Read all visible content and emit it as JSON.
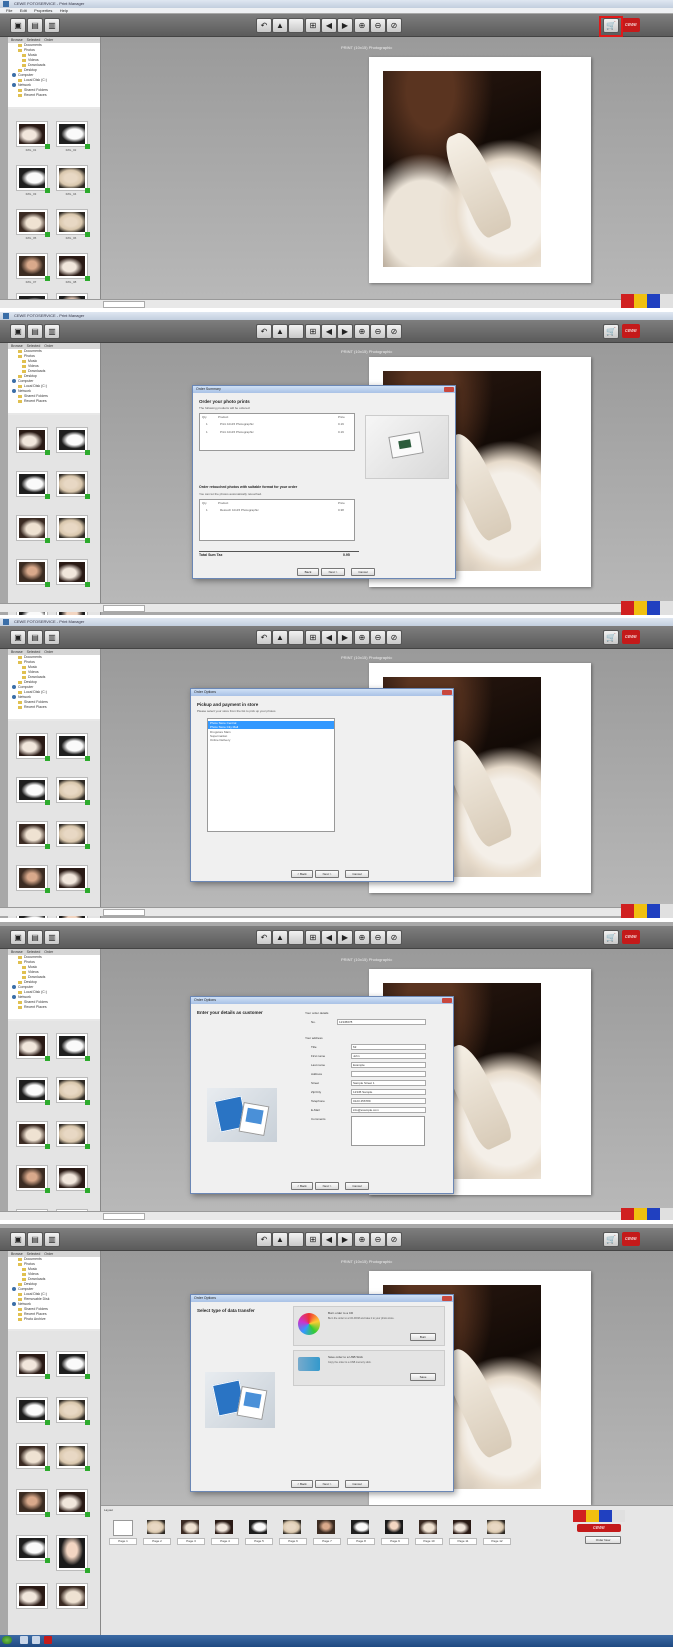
{
  "app": {
    "title": "CEWE FOTOSERVICE - Print Manager",
    "menu": [
      "File",
      "Edit",
      "Properties",
      "Help"
    ],
    "page_title": "PRINT (10x15) Photographic"
  },
  "toolbar": {
    "left_buttons": [
      {
        "name": "new-icon",
        "glyph": "▣"
      },
      {
        "name": "open-folder-icon",
        "glyph": "▤"
      },
      {
        "name": "save-icon",
        "glyph": "▥"
      }
    ],
    "center_buttons": [
      {
        "name": "undo-icon",
        "glyph": "↶"
      },
      {
        "name": "image-icon",
        "glyph": "▲"
      },
      {
        "name": "blank-icon",
        "glyph": " "
      },
      {
        "name": "grid-icon",
        "glyph": "⊞"
      },
      {
        "name": "prev-icon",
        "glyph": "◀"
      },
      {
        "name": "next-icon",
        "glyph": "▶"
      },
      {
        "name": "zoom-in-icon",
        "glyph": "⊕"
      },
      {
        "name": "zoom-out-icon",
        "glyph": "⊖"
      },
      {
        "name": "zoom-fit-icon",
        "glyph": "⊘"
      }
    ],
    "order_button": {
      "name": "order-cart-icon",
      "glyph": "🛒"
    },
    "logo_text": "cewe"
  },
  "sidebar": {
    "tabs": [
      "Browse",
      "Selected",
      "Order",
      "Print Attributes"
    ],
    "tree": [
      {
        "label": "Documents",
        "level": 1
      },
      {
        "label": "Photos",
        "level": 1
      },
      {
        "label": "Music",
        "level": 1
      },
      {
        "label": "Videos",
        "level": 1
      },
      {
        "label": "Downloads",
        "level": 1
      },
      {
        "label": "Desktop",
        "level": 1
      },
      {
        "label": "Computer",
        "level": 0
      },
      {
        "label": "Local Disk (C:)",
        "level": 1
      },
      {
        "label": "Removable Disk",
        "level": 1
      },
      {
        "label": "Network",
        "level": 0
      },
      {
        "label": "Shared Folders",
        "level": 1
      },
      {
        "label": "Recent Places",
        "level": 1
      },
      {
        "label": "Photo Archive",
        "level": 1
      }
    ],
    "thumbnails": [
      {
        "label": "IMG_01",
        "img": "img-a"
      },
      {
        "label": "IMG_02",
        "img": "img-b"
      },
      {
        "label": "IMG_03",
        "img": "img-b"
      },
      {
        "label": "IMG_04",
        "img": "img-d"
      },
      {
        "label": "IMG_05",
        "img": "img-c"
      },
      {
        "label": "IMG_06",
        "img": "img-d"
      },
      {
        "label": "IMG_07",
        "img": "img-e"
      },
      {
        "label": "IMG_08",
        "img": "img-a"
      },
      {
        "label": "IMG_09",
        "img": "img-b"
      },
      {
        "label": "IMG_10",
        "img": "img-f"
      }
    ]
  },
  "dialogs": {
    "order_summary": {
      "title": "Order Summary",
      "heading1": "Order your photo prints",
      "sub1": "The following products will be ordered:",
      "col_quantity": "Qty",
      "col_product": "Product",
      "col_price": "Price",
      "rows1": [
        {
          "qty": "1",
          "product": "Print 10x15 Photographic",
          "price": "0.19"
        },
        {
          "qty": "1",
          "product": "Print 10x15 Photographic",
          "price": "0.19"
        }
      ],
      "heading2": "Order retouched photos with suitable format for your order",
      "sub2": "You can let the photos automatically retouched.",
      "rows2": [
        {
          "qty": "1",
          "product": "Retouch 10x15 Photographic",
          "price": "0.38"
        }
      ],
      "total_label": "Total Sum  Tax",
      "total_value": "0.95",
      "buttons": [
        "Back",
        "Next >",
        "Cancel"
      ]
    },
    "pickup": {
      "title": "Order Options",
      "heading": "Pickup and payment in store",
      "sub": "Please select your store from the list to pick up your photos",
      "options": [
        "Photo Store Central",
        "Photo Store City Mall",
        "Drugstore Main",
        "Supermarket",
        "Online Delivery"
      ],
      "selected_count": 2,
      "buttons": [
        "< Back",
        "Next >",
        "Cancel"
      ]
    },
    "customer": {
      "title": "Order Options",
      "heading": "Enter your details as customer",
      "order_label": "Your order details",
      "order_number_label": "No.",
      "order_number_value": "12345678",
      "customer_label": "Your address",
      "fields": [
        {
          "label": "Title",
          "value": "Mr."
        },
        {
          "label": "First name",
          "value": "John"
        },
        {
          "label": "Last name",
          "value": "Example"
        },
        {
          "label": "Address",
          "value": ""
        },
        {
          "label": "Street",
          "value": "Sample Street 1"
        },
        {
          "label": "Zip/City",
          "value": "12345 Sample"
        },
        {
          "label": "Telephone",
          "value": "0123 456789"
        },
        {
          "label": "E-Mail",
          "value": "info@example.com"
        },
        {
          "label": "Comments",
          "value": ""
        }
      ],
      "buttons": [
        "< Back",
        "Next >",
        "Cancel"
      ]
    },
    "data_transfer": {
      "title": "Order Options",
      "heading": "Select type of data transfer",
      "options": [
        {
          "title": "Burn order to a CD",
          "desc": "Burn the order to a CD-ROM and take it to your photo store.",
          "button": "Burn"
        },
        {
          "title": "Save order to a USB Stick",
          "desc": "Copy the order to a USB memory stick.",
          "button": "Save"
        }
      ],
      "buttons": [
        "< Back",
        "Next >",
        "Cancel"
      ]
    }
  },
  "layouts": {
    "label": "Layout",
    "items": [
      "Page 1",
      "Page 2",
      "Page 3",
      "Page 4",
      "Page 5",
      "Page 6",
      "Page 7",
      "Page 8",
      "Page 9",
      "Page 10",
      "Page 11",
      "Page 12"
    ],
    "logo_text": "cewe",
    "order_button": "Order Now"
  },
  "colors": {
    "accent": "#3399ff",
    "brand": "#c41a1a",
    "highlight": "#e01818"
  }
}
